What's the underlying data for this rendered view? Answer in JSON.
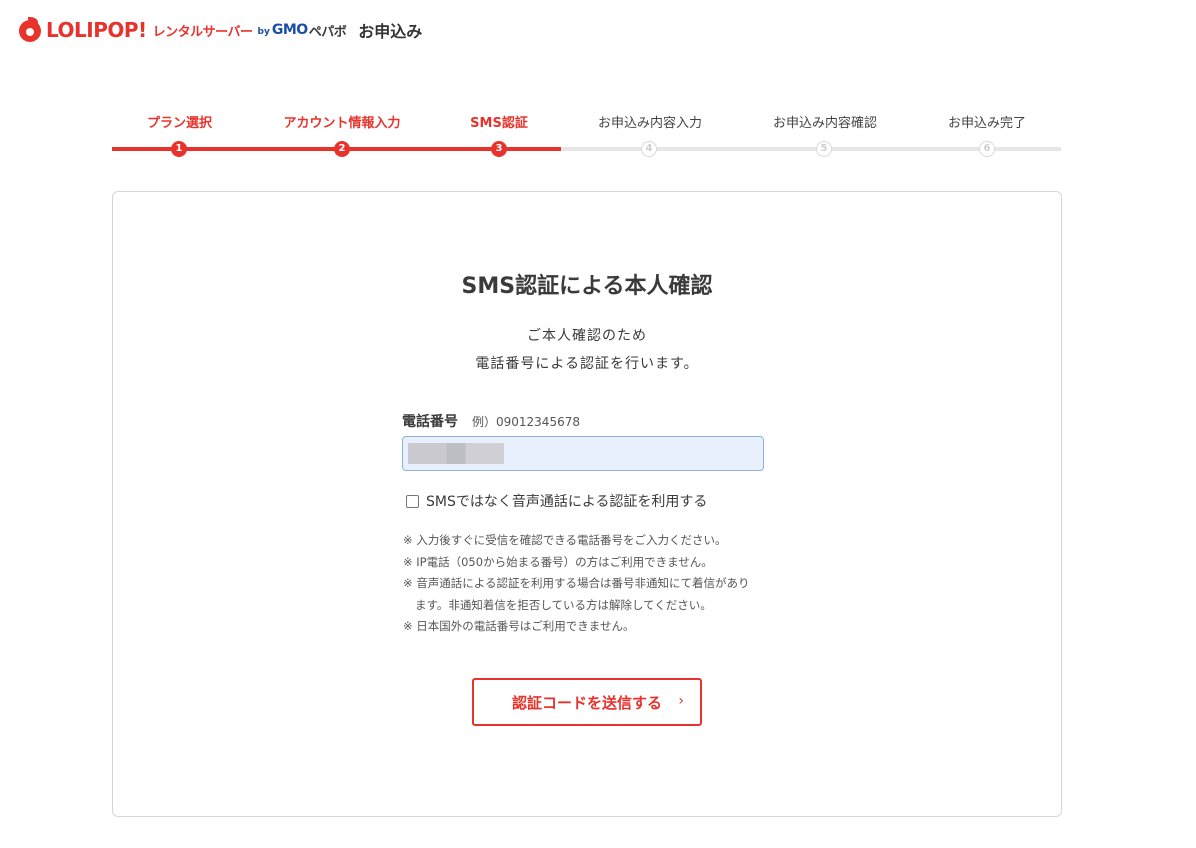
{
  "header": {
    "logo_text": "LOLIPOP!",
    "logo_sub": "レンタルサーバー",
    "by_text": "by",
    "gmo_text": "GMO",
    "pepabo_text": "ペパボ",
    "page_title": "お申込み"
  },
  "stepper": {
    "steps": [
      {
        "label": "プラン選択",
        "num": "1",
        "status": "done"
      },
      {
        "label": "アカウント情報入力",
        "num": "2",
        "status": "done"
      },
      {
        "label": "SMS認証",
        "num": "3",
        "status": "current"
      },
      {
        "label": "お申込み内容入力",
        "num": "4",
        "status": "todo"
      },
      {
        "label": "お申込み内容確認",
        "num": "5",
        "status": "todo"
      },
      {
        "label": "お申込み完了",
        "num": "6",
        "status": "todo"
      }
    ]
  },
  "card": {
    "title": "SMS認証による本人確認",
    "desc_line1": "ご本人確認のため",
    "desc_line2": "電話番号による認証を行います。",
    "phone_label": "電話番号",
    "phone_example": "例）09012345678",
    "phone_value": "",
    "voice_label": "SMSではなく音声通話による認証を利用する",
    "voice_checked": false,
    "notes": [
      "※ 入力後すぐに受信を確認できる電話番号をご入力ください。",
      "※ IP電話（050から始まる番号）の方はご利用できません。",
      "※ 音声通話による認証を利用する場合は番号非通知にて着信があり",
      "ます。非通知着信を拒否している方は解除してください。",
      "※ 日本国外の電話番号はご利用できません。"
    ],
    "send_button": "認証コードを送信する",
    "send_chevron": "›"
  },
  "colors": {
    "accent": "#e8332c",
    "brand_blue": "#1b4fa5",
    "track_inactive": "#e6e6e6",
    "input_fill": "#e8f0fe"
  }
}
